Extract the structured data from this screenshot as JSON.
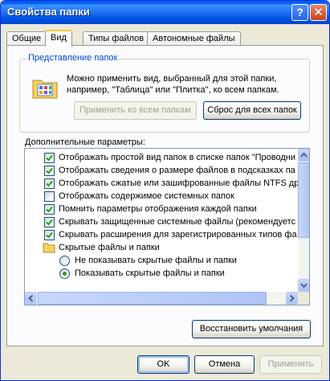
{
  "window": {
    "title": "Свойства папки",
    "help_glyph": "?",
    "close_glyph": "✕"
  },
  "tabs": [
    {
      "label": "Общие"
    },
    {
      "label": "Вид"
    },
    {
      "label": "Типы файлов"
    },
    {
      "label": "Автономные файлы"
    }
  ],
  "folder_views": {
    "title": "Представление папок",
    "description": "Можно применить вид, выбранный для этой папки, например, \"Таблица\" или \"Плитка\", ко всем папкам.",
    "apply_all_label": "Применить ко всем папкам",
    "reset_all_label": "Сброс для всех папок"
  },
  "advanced": {
    "label": "Дополнительные параметры:",
    "items": [
      {
        "type": "checkbox",
        "checked": true,
        "text": "Отображать простой вид папок в списке папок \"Проводни"
      },
      {
        "type": "checkbox",
        "checked": true,
        "text": "Отображать сведения о размере файлов в подсказках па"
      },
      {
        "type": "checkbox",
        "checked": true,
        "text": "Отображать сжатые или зашифрованные файлы NTFS др"
      },
      {
        "type": "checkbox",
        "checked": false,
        "text": "Отображать содержимое системных папок"
      },
      {
        "type": "checkbox",
        "checked": true,
        "text": "Помнить параметры отображения каждой папки"
      },
      {
        "type": "checkbox",
        "checked": true,
        "text": "Скрывать защищенные системные файлы (рекомендуетс"
      },
      {
        "type": "checkbox",
        "checked": true,
        "text": "Скрывать расширения для зарегистрированных типов фа"
      },
      {
        "type": "folder",
        "text": "Скрытые файлы и папки"
      },
      {
        "type": "radio",
        "checked": false,
        "text": "Не показывать скрытые файлы и папки"
      },
      {
        "type": "radio",
        "checked": true,
        "text": "Показывать скрытые файлы и папки"
      }
    ]
  },
  "buttons": {
    "restore_defaults": "Восстановить умолчания",
    "ok": "OK",
    "cancel": "Отмена",
    "apply": "Применить"
  },
  "colors": {
    "titlebar": "#0058EE",
    "dialog_bg": "#ECE9D8",
    "group_title": "#0046D5",
    "check_mark": "#21A121"
  }
}
